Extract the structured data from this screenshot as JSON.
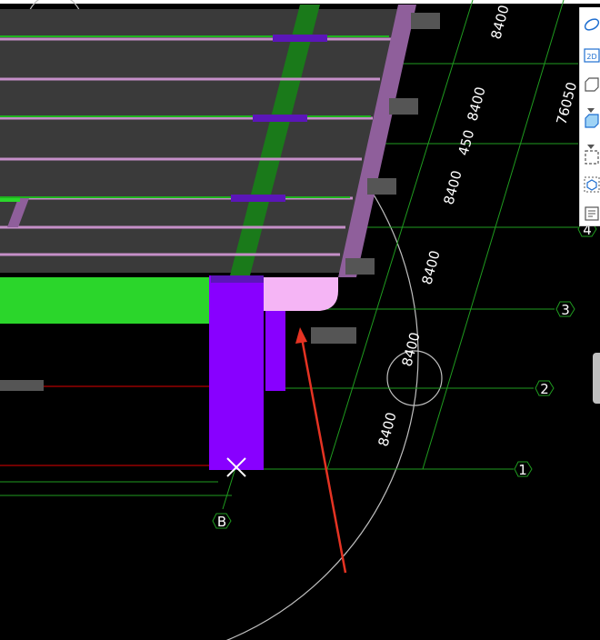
{
  "viewport": {
    "background": "#000000"
  },
  "colors": {
    "slab": "#3a3a3a",
    "beam_pink": "#c58fc8",
    "edge_beam": "#8f5f9b",
    "purple": "#8800ff",
    "green_beam": "#2bd62b",
    "green_vertical": "#1a7a1a",
    "grid_line": "#1f9b1f",
    "red_line": "#e00000",
    "arrow": "#e53323",
    "light_pink": "#f5b5f5"
  },
  "dimensions": {
    "d1": "8400",
    "d2": "8400",
    "d3": "450",
    "d4": "8400",
    "d5": "8400",
    "d6": "8400",
    "d7": "8400",
    "d8": "76050"
  },
  "axes": {
    "a1": "1",
    "a2": "2",
    "a3": "3",
    "a4": "4",
    "ab": "B"
  },
  "toolbar": {
    "icons": [
      "orbit-icon",
      "2d-view-icon",
      "box-view-icon",
      "chevron-down-icon",
      "solid-box-icon",
      "chevron-down-icon",
      "selection-box-icon",
      "cube-select-icon",
      "properties-list-icon"
    ],
    "label_2d": "2D"
  }
}
